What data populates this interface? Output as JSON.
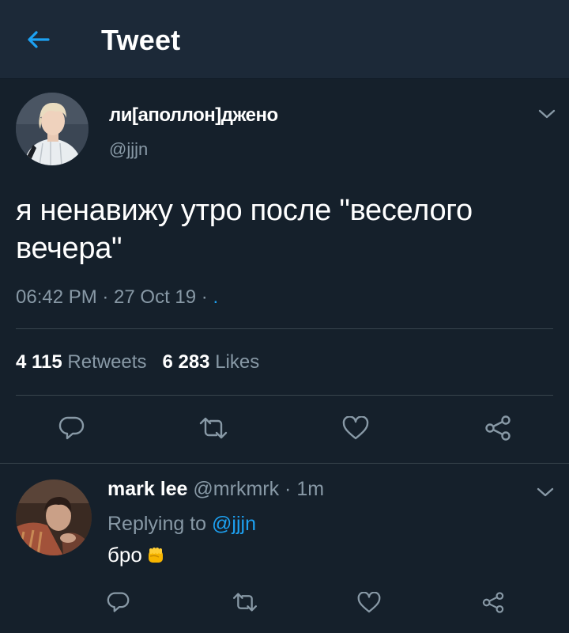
{
  "header": {
    "title": "Tweet",
    "back_icon": "arrow-left-icon",
    "accent_color": "#1da1f2",
    "background": "#1c2938"
  },
  "tweet": {
    "author_name": "ли[аполлон]джено",
    "author_handle": "@jjjn",
    "text_line1": "я ненавижу утро после \"веселого",
    "text_line2": "вечера\"",
    "timestamp": "06:42 PM · 27 Oct 19 · ",
    "source": ".",
    "retweets_count": "4 115",
    "retweets_label": "Retweets",
    "likes_count": "6 283",
    "likes_label": "Likes",
    "caret_icon": "chevron-down-icon",
    "actions": [
      "reply-icon",
      "retweet-icon",
      "like-icon",
      "share-icon"
    ]
  },
  "reply": {
    "author_name": "mark lee",
    "author_handle": "@mrkmrk",
    "separator": " · ",
    "time": "1m",
    "replying_prefix": "Replying to ",
    "replying_to": "@jjjn",
    "text": "бро",
    "emoji_icon": "raised-fist-emoji-icon",
    "actions": [
      "reply-icon",
      "retweet-icon",
      "like-icon",
      "share-icon"
    ]
  },
  "colors": {
    "background": "#15202b",
    "secondary_text": "#8899a6",
    "divider": "#38444d",
    "link": "#1da1f2"
  }
}
